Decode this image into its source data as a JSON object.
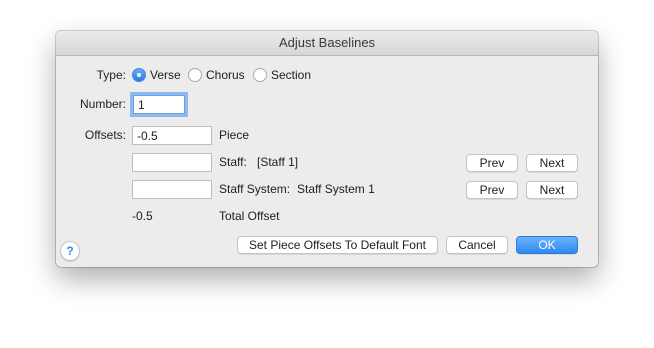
{
  "window": {
    "title": "Adjust Baselines"
  },
  "type": {
    "label": "Type:",
    "options": [
      {
        "label": "Verse",
        "selected": true
      },
      {
        "label": "Chorus",
        "selected": false
      },
      {
        "label": "Section",
        "selected": false
      }
    ]
  },
  "number": {
    "label": "Number:",
    "value": "1"
  },
  "offsets": {
    "label": "Offsets:",
    "piece": {
      "value": "-0.5",
      "label": "Piece"
    },
    "staff": {
      "value": "",
      "label": "Staff:",
      "name": "[Staff 1]",
      "prev": "Prev",
      "next": "Next"
    },
    "staff_system": {
      "value": "",
      "label": "Staff System:",
      "name": "Staff System 1",
      "prev": "Prev",
      "next": "Next"
    },
    "total": {
      "value": "-0.5",
      "label": "Total Offset"
    }
  },
  "buttons": {
    "reset": "Set Piece Offsets To Default Font",
    "cancel": "Cancel",
    "ok": "OK",
    "help": "?"
  },
  "colors": {
    "accent": "#3b88e6",
    "window_bg": "#ececec"
  },
  "icons": {
    "help": "question-mark-icon"
  }
}
